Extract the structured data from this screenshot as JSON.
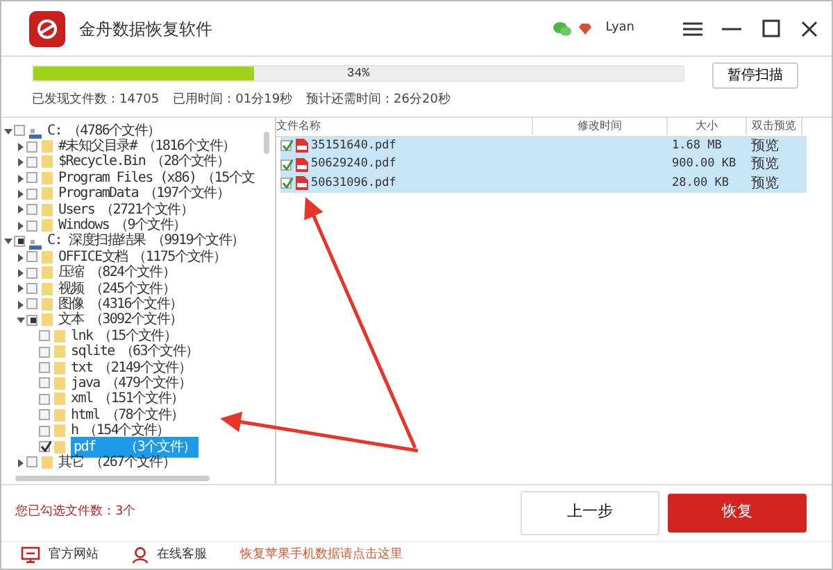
{
  "window": {
    "title": "金舟数据恢复软件",
    "user": "Lyan"
  },
  "scan": {
    "level": 0.34,
    "percent": "34%",
    "found": "已发现文件数：14705",
    "elapsed": "已用时间：01分19秒",
    "remaining": "预计还需时间：26分20秒",
    "pause_button": "暂停扫描"
  },
  "tree": [
    {
      "kind": "drive",
      "label": "C:",
      "count": "（4786个文件）",
      "checked": false,
      "partial": false,
      "expanded": true,
      "children": [
        {
          "kind": "folder",
          "label": "#未知父目录#",
          "count": "（1816个文件）",
          "checked": false,
          "partial": false,
          "expanded": false
        },
        {
          "kind": "folder",
          "label": "$Recycle.Bin",
          "count": "（28个文件）",
          "checked": false,
          "partial": false,
          "expanded": false
        },
        {
          "kind": "folder",
          "label": "Program Files (x86)",
          "count": "（15个文",
          "checked": false,
          "partial": false,
          "expanded": false
        },
        {
          "kind": "folder",
          "label": "ProgramData",
          "count": "（197个文件）",
          "checked": false,
          "partial": false,
          "expanded": false
        },
        {
          "kind": "folder",
          "label": "Users",
          "count": "（2721个文件）",
          "checked": false,
          "partial": false,
          "expanded": false
        },
        {
          "kind": "folder",
          "label": "Windows",
          "count": "（9个文件）",
          "checked": false,
          "partial": false,
          "expanded": false
        }
      ]
    },
    {
      "kind": "drive",
      "label": "C: 深度扫描结果",
      "count": "（9919个文件）",
      "checked": false,
      "partial": true,
      "expanded": true,
      "children": [
        {
          "kind": "folder",
          "label": "OFFICE文档",
          "count": "（1175个文件）",
          "checked": false,
          "partial": false,
          "expanded": false
        },
        {
          "kind": "folder",
          "label": "压缩",
          "count": "（824个文件）",
          "checked": false,
          "partial": false,
          "expanded": false
        },
        {
          "kind": "folder",
          "label": "视频",
          "count": "（245个文件）",
          "checked": false,
          "partial": false,
          "expanded": false
        },
        {
          "kind": "folder",
          "label": "图像",
          "count": "（4316个文件）",
          "checked": false,
          "partial": false,
          "expanded": false
        },
        {
          "kind": "folder",
          "label": "文本",
          "count": "（3092个文件）",
          "checked": false,
          "partial": true,
          "expanded": true,
          "children": [
            {
              "kind": "folder",
              "label": "lnk",
              "count": "（15个文件）",
              "checked": false,
              "partial": false,
              "selected": false
            },
            {
              "kind": "folder",
              "label": "sqlite",
              "count": "（63个文件）",
              "checked": false,
              "partial": false,
              "selected": false
            },
            {
              "kind": "folder",
              "label": "txt",
              "count": "（2149个文件）",
              "checked": false,
              "partial": false,
              "selected": false
            },
            {
              "kind": "folder",
              "label": "java",
              "count": "（479个文件）",
              "checked": false,
              "partial": false,
              "selected": false
            },
            {
              "kind": "folder",
              "label": "xml",
              "count": "（151个文件）",
              "checked": false,
              "partial": false,
              "selected": false
            },
            {
              "kind": "folder",
              "label": "html",
              "count": "（78个文件）",
              "checked": false,
              "partial": false,
              "selected": false
            },
            {
              "kind": "folder",
              "label": "h",
              "count": "（154个文件）",
              "checked": false,
              "partial": false,
              "selected": false
            },
            {
              "kind": "folder",
              "label": "pdf",
              "count": "（3个文件）",
              "checked": true,
              "partial": false,
              "selected": true
            }
          ]
        },
        {
          "kind": "folder",
          "label": "其它",
          "count": "（267个文件）",
          "checked": false,
          "partial": false,
          "expanded": false
        }
      ]
    }
  ],
  "files": {
    "columns": [
      "文件名称",
      "修改时间",
      "大小",
      "双击预览"
    ],
    "rows": [
      {
        "name": "35151640.pdf",
        "size": "1.68 MB",
        "preview": "预览",
        "checked": true,
        "selected": true
      },
      {
        "name": "50629240.pdf",
        "size": "900.00 KB",
        "preview": "预览",
        "checked": true,
        "selected": true
      },
      {
        "name": "50631096.pdf",
        "size": "28.00 KB",
        "preview": "预览",
        "checked": true,
        "selected": true
      }
    ]
  },
  "selected_count": "您已勾选文件数：3个",
  "buttons": {
    "back": "上一步",
    "recover": "恢复"
  },
  "footer": {
    "website": "官方网站",
    "support": "在线客服",
    "apple_link": "恢复苹果手机数据请点击这里"
  }
}
